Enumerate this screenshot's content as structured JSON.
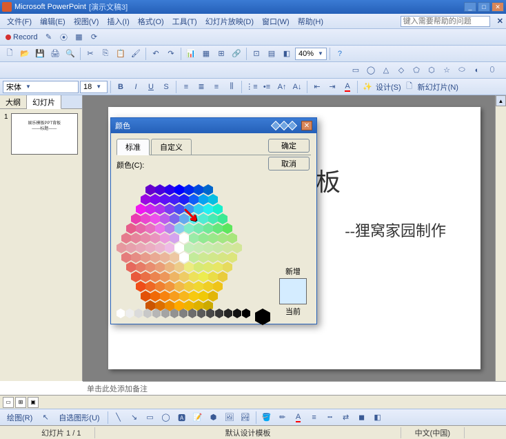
{
  "app": {
    "name": "Microsoft PowerPoint",
    "doc": "[演示文稿3]"
  },
  "menu": {
    "file": "文件(F)",
    "edit": "编辑(E)",
    "view": "视图(V)",
    "insert": "插入(I)",
    "format": "格式(O)",
    "tools": "工具(T)",
    "slideshow": "幻灯片放映(D)",
    "window": "窗口(W)",
    "help": "帮助(H)"
  },
  "help_placeholder": "键入需要帮助的问题",
  "record": "Record",
  "font": {
    "name": "宋体",
    "size": "18"
  },
  "zoom": "40%",
  "tabs": {
    "outline": "大纲",
    "slides": "幻灯片"
  },
  "thumb": {
    "title": "娱乐模板PPT背板",
    "sub": "——标题——"
  },
  "slide": {
    "title": "PPT模板",
    "sub": "--狸窝家园制作"
  },
  "notes": "单击此处添加备注",
  "dialog": {
    "title": "颜色",
    "tab_std": "标准",
    "tab_custom": "自定义",
    "label": "颜色(C):",
    "ok": "确定",
    "cancel": "取消",
    "new": "新增",
    "current": "当前"
  },
  "draw": {
    "menu": "绘图(R)",
    "autoshape": "自选图形(U)"
  },
  "design": "设计(S)",
  "newslide": "新幻灯片(N)",
  "status": {
    "slide": "幻灯片 1 / 1",
    "template": "默认设计模板",
    "lang": "中文(中国)"
  }
}
